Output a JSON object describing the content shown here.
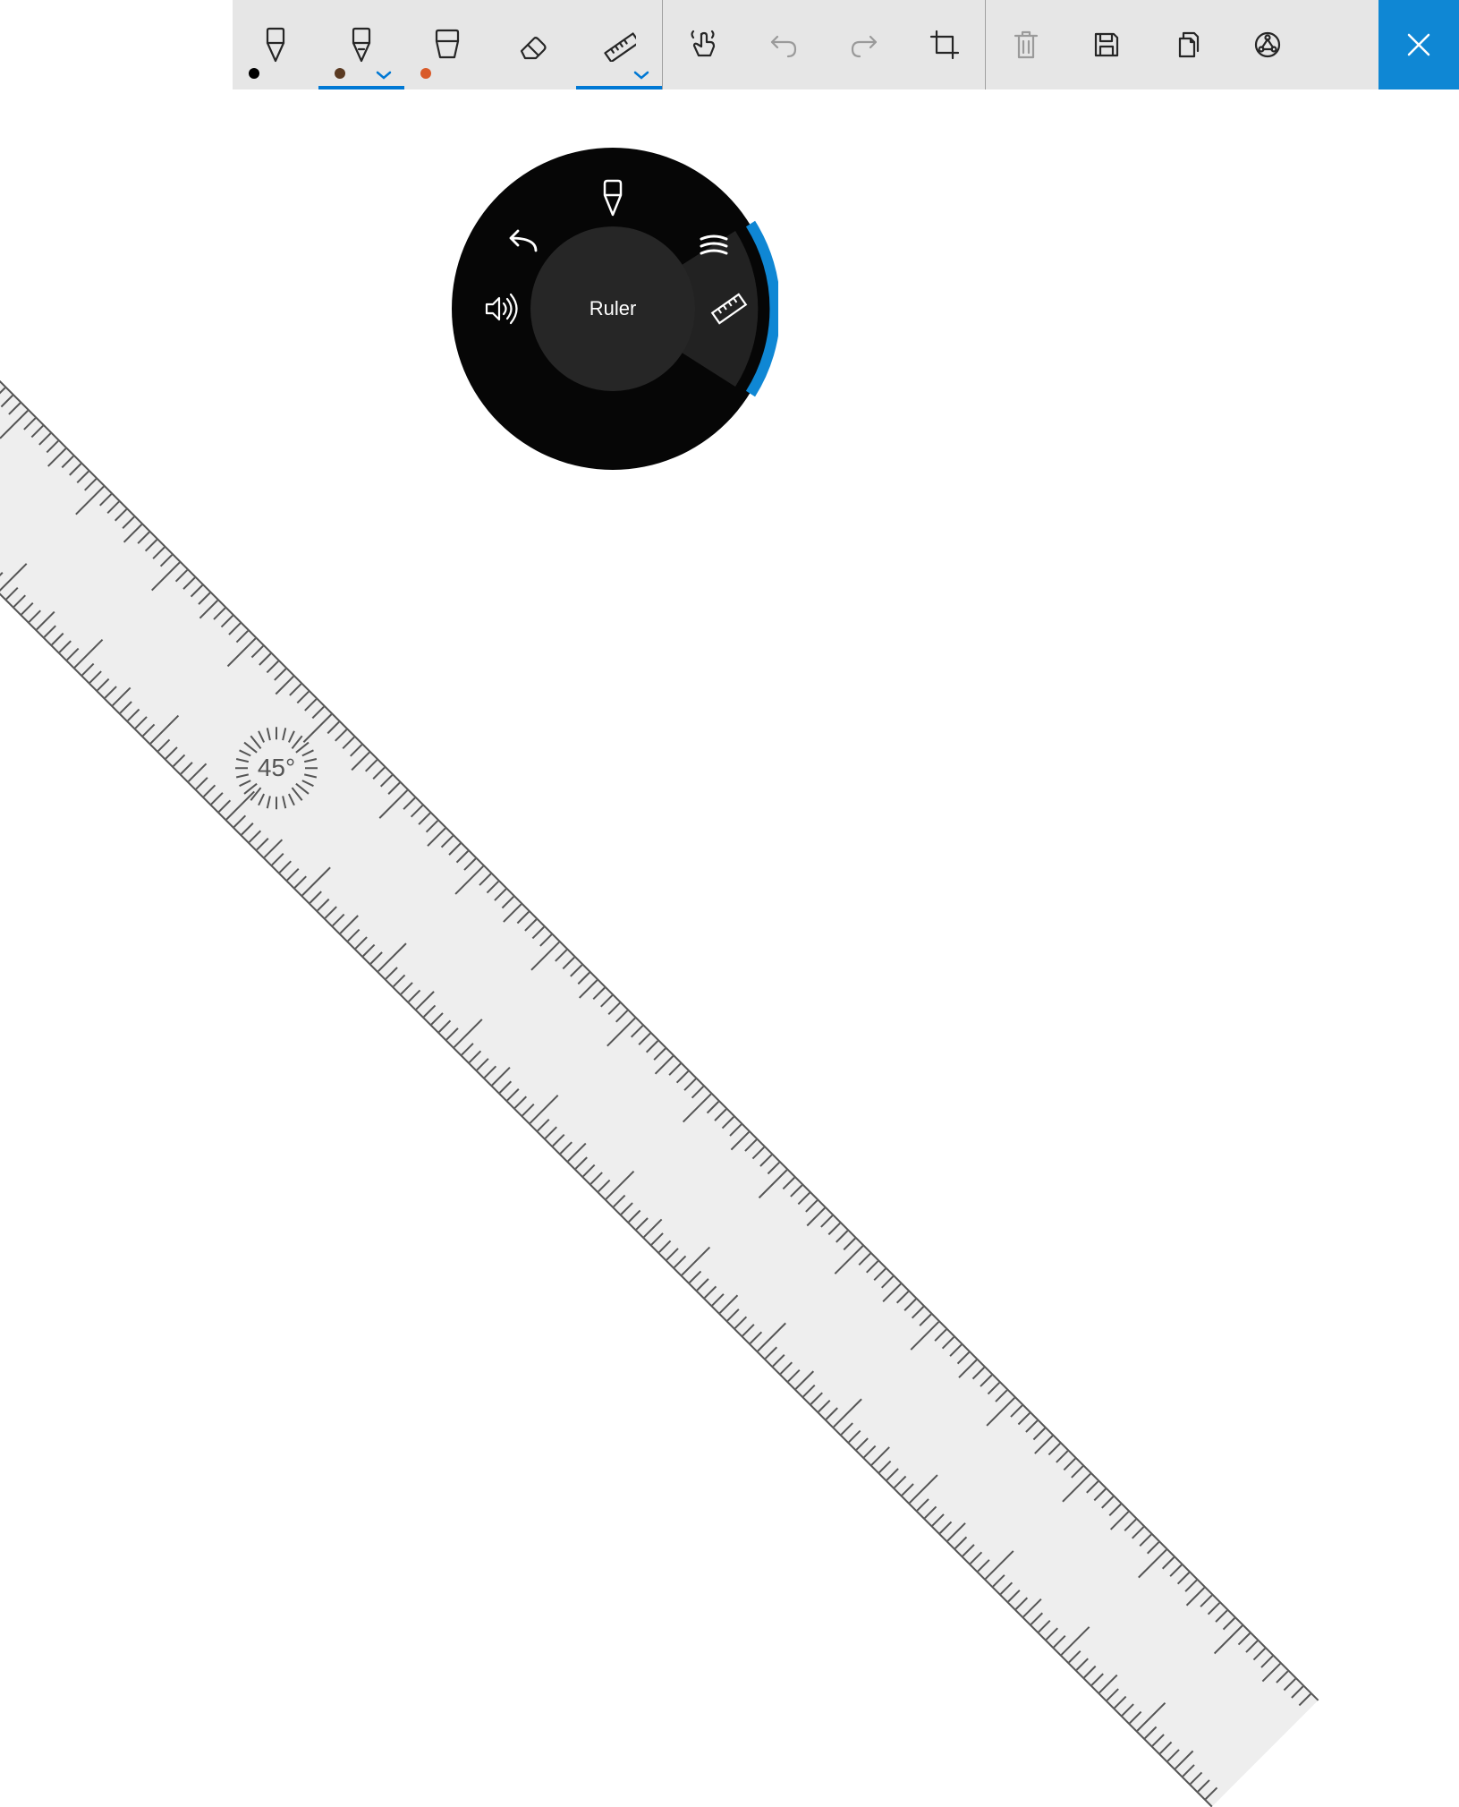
{
  "toolbar": {
    "pens": [
      {
        "name": "ballpoint-pen",
        "color": "#000000",
        "has_dropdown": false,
        "active": false
      },
      {
        "name": "pencil",
        "color": "#5a3a22",
        "has_dropdown": true,
        "active": true
      },
      {
        "name": "highlighter",
        "color": "#d95b2a",
        "has_dropdown": false,
        "active": false
      }
    ],
    "eraser_label": "Eraser",
    "ruler_label": "Ruler",
    "ruler_active": true,
    "touch_label": "Touch writing",
    "undo_label": "Undo",
    "redo_label": "Redo",
    "crop_label": "Crop",
    "delete_label": "Delete",
    "save_label": "Save",
    "copy_label": "Copy",
    "share_label": "Share",
    "close_label": "Close",
    "accent_color": "#0f87d4"
  },
  "ruler": {
    "angle_text": "45°",
    "angle_deg": 45
  },
  "radial": {
    "center_label": "Ruler",
    "selected": "ruler",
    "items": [
      {
        "id": "pen",
        "name": "pen-icon"
      },
      {
        "id": "stack",
        "name": "layers-icon"
      },
      {
        "id": "ruler",
        "name": "ruler-icon"
      },
      {
        "id": "volume",
        "name": "volume-icon"
      },
      {
        "id": "undo",
        "name": "undo-icon"
      }
    ]
  }
}
